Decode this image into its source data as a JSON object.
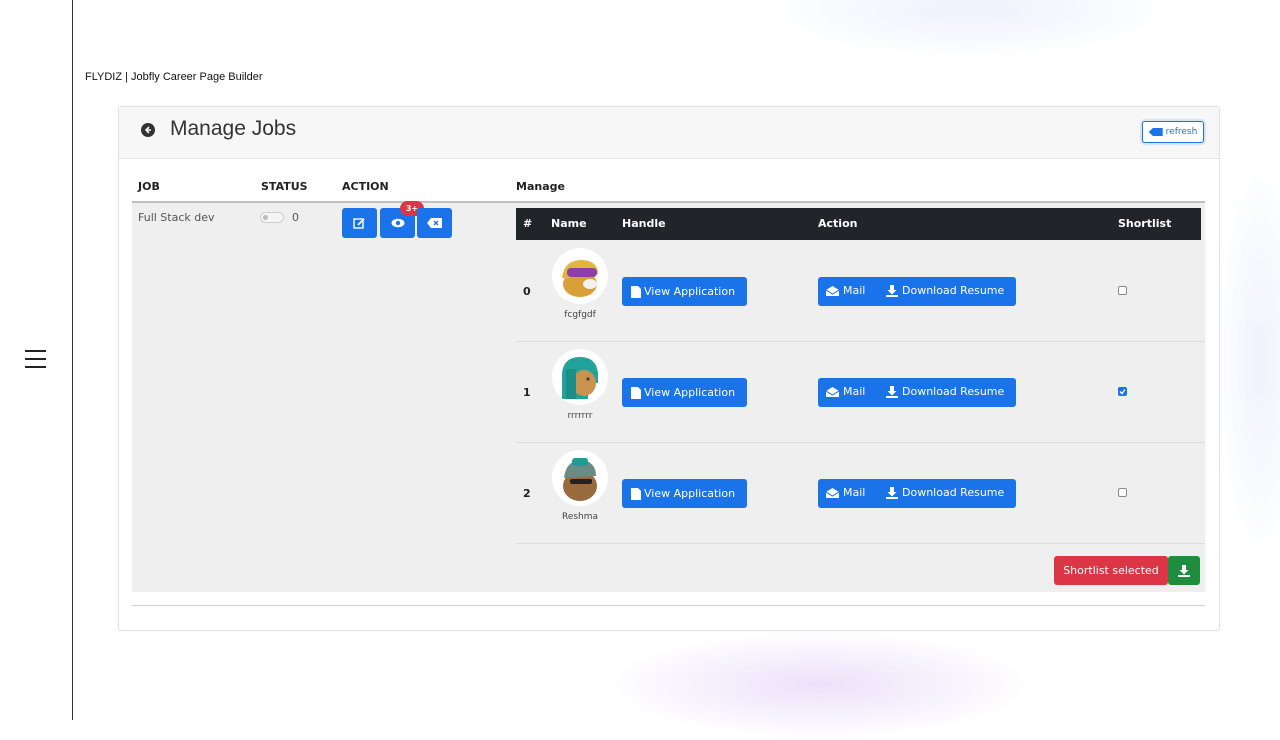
{
  "brand": "FLYDIZ | Jobfly Career Page Builder",
  "card": {
    "title": "Manage Jobs",
    "refresh_label": "refresh"
  },
  "columns": {
    "job": "JOB",
    "status": "STATUS",
    "action": "ACTION",
    "manage": "Manage"
  },
  "job": {
    "name": "Full Stack dev",
    "status_count": "0",
    "badge": "3+"
  },
  "applicants_table": {
    "headers": {
      "num": "#",
      "name": "Name",
      "handle": "Handle",
      "action": "Action",
      "shortlist": "Shortlist"
    },
    "view_label": "View Application",
    "mail_label": "Mail",
    "download_label": "Download Resume",
    "rows": [
      {
        "index": "0",
        "name": "fcgfgdf",
        "shortlisted": false
      },
      {
        "index": "1",
        "name": "rrrrrrr",
        "shortlisted": true
      },
      {
        "index": "2",
        "name": "Reshma",
        "shortlisted": false
      }
    ]
  },
  "footer": {
    "shortlist_label": "Shortlist selected"
  },
  "colors": {
    "primary": "#1a73e8",
    "danger": "#dc3545",
    "success": "#1e8e3e",
    "table_head": "#212529"
  }
}
